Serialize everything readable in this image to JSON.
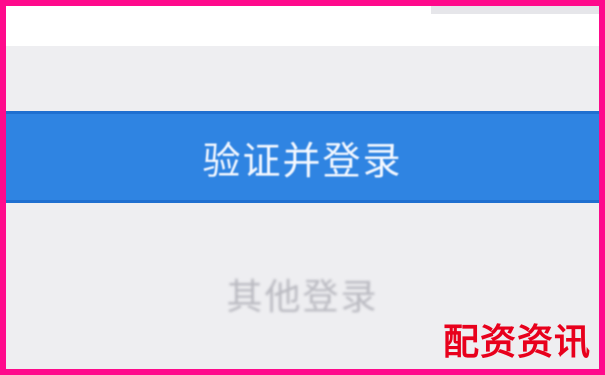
{
  "form": {
    "verify_login_label": "验证并登录",
    "secondary_label": "其他登录"
  },
  "watermark": {
    "text": "配资资讯"
  },
  "colors": {
    "frame_border": "#ff0a8c",
    "primary_button": "#2f84e2",
    "background": "#eeeef1",
    "watermark": "#e8001c"
  }
}
